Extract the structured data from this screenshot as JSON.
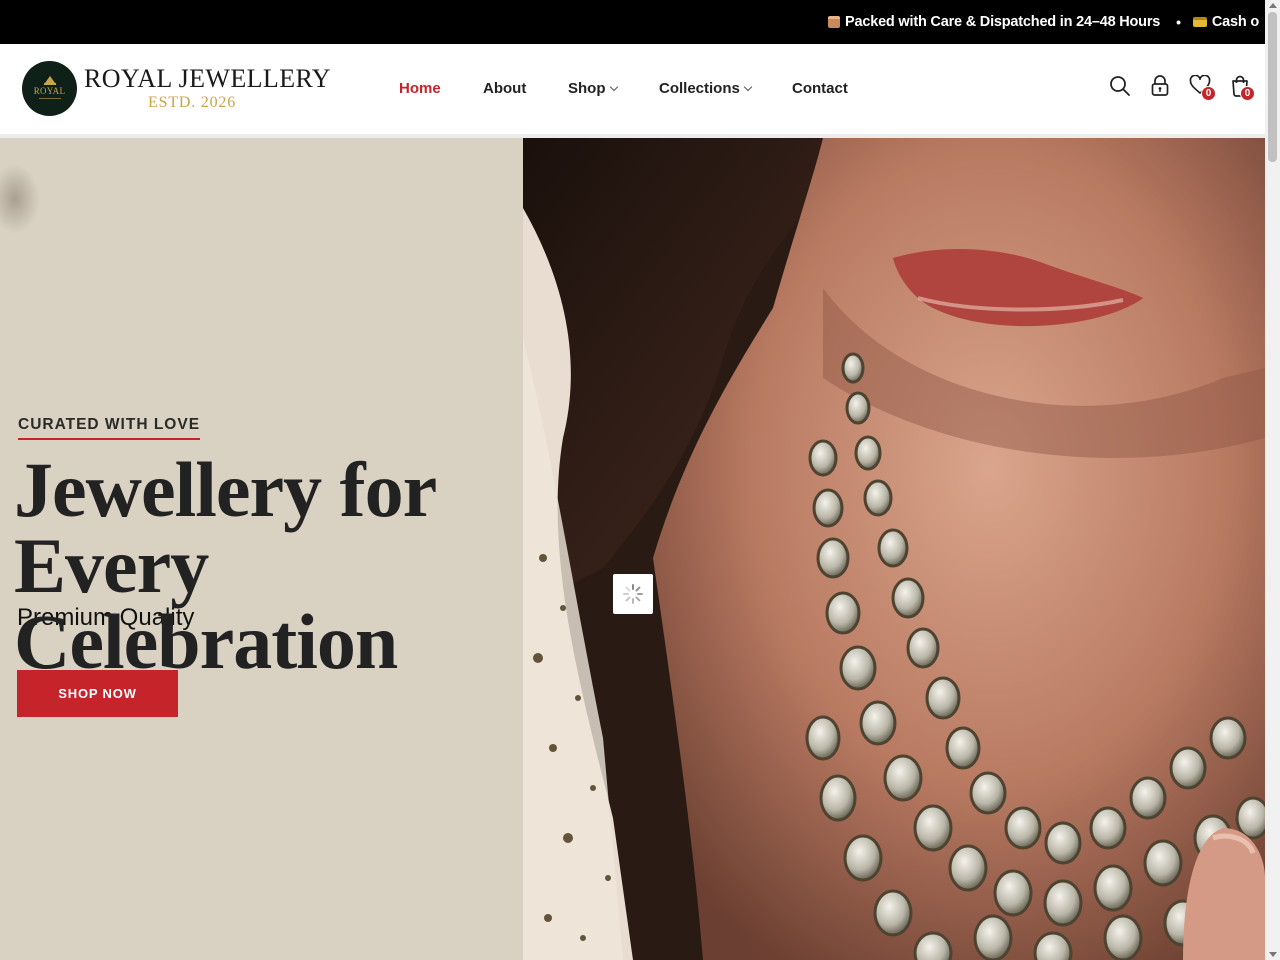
{
  "announcement": {
    "item1_icon": "package-icon",
    "item1_text": "Packed with Care & Dispatched in 24–48 Hours",
    "separator": "•",
    "item2_icon": "credit-card-icon",
    "item2_text": "Cash o"
  },
  "brand": {
    "logo_text": "ROYAL",
    "name": "ROYAL JEWELLERY",
    "established": "ESTD. 2026"
  },
  "nav": {
    "home": "Home",
    "about": "About",
    "shop": "Shop",
    "collections": "Collections",
    "contact": "Contact"
  },
  "header_icons": {
    "search": "search-icon",
    "account": "lock-icon",
    "wishlist": "heart-icon",
    "wishlist_count": "0",
    "cart": "shopping-bag-icon",
    "cart_count": "0"
  },
  "hero": {
    "eyebrow": "CURATED WITH LOVE",
    "title_line1": "Jewellery for Every",
    "title_line2": "Celebration",
    "subtitle": "Premium Quality",
    "cta": "SHOP NOW",
    "image_alt": "woman wearing layered kundan necklace"
  },
  "colors": {
    "accent": "#c4242a",
    "gold": "#c9a44a",
    "hero_bg": "#d9d1c1",
    "logo_bg": "#0f2018"
  }
}
